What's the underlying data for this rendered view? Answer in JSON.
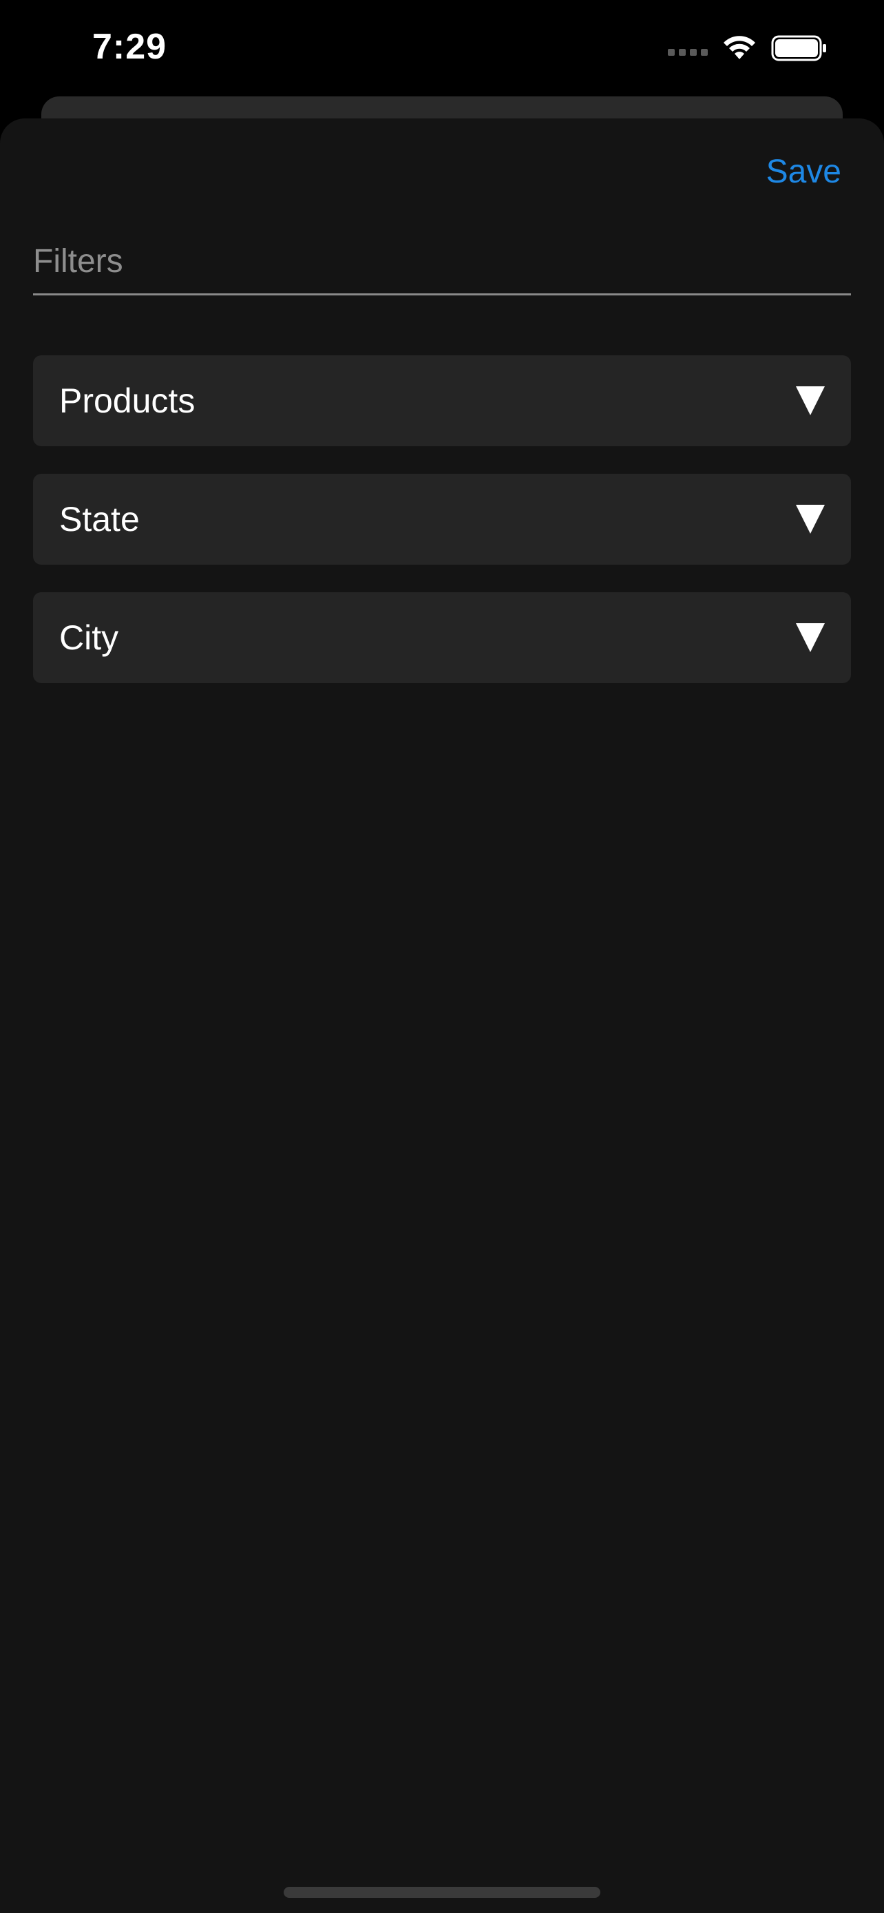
{
  "status_bar": {
    "time": "7:29",
    "icons": [
      "signal-icon",
      "wifi-icon",
      "battery-icon"
    ]
  },
  "sheet": {
    "save_label": "Save",
    "filters_placeholder": "Filters",
    "filters_value": "",
    "dropdowns": [
      {
        "label": "Products",
        "icon": "triangle-down-icon"
      },
      {
        "label": "State",
        "icon": "triangle-down-icon"
      },
      {
        "label": "City",
        "icon": "triangle-down-icon"
      }
    ]
  },
  "colors": {
    "background": "#141414",
    "accent": "#1e88e5",
    "dropdown_bg": "#252525",
    "text": "#ffffff",
    "placeholder": "#8e8e8e"
  }
}
